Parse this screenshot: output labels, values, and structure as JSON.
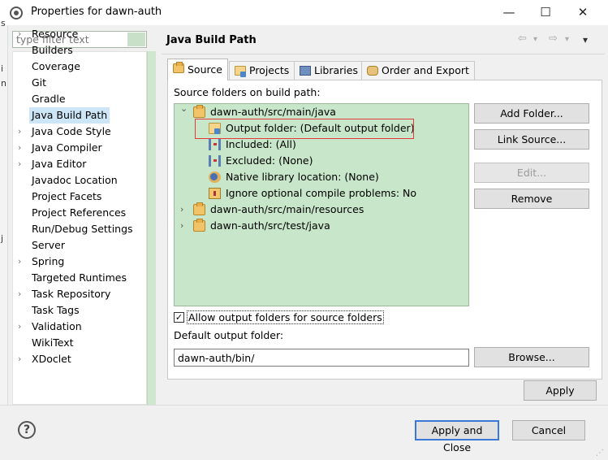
{
  "window": {
    "title": "Properties for dawn-auth",
    "minimize_glyph": "—",
    "maximize_glyph": "☐",
    "close_glyph": "✕"
  },
  "left_strip_chars": [
    "s",
    "i",
    "n",
    "j"
  ],
  "filter": {
    "placeholder": "type filter text"
  },
  "nav": [
    {
      "label": "Resource",
      "expandable": true
    },
    {
      "label": "Builders",
      "expandable": false
    },
    {
      "label": "Coverage",
      "expandable": false
    },
    {
      "label": "Git",
      "expandable": false
    },
    {
      "label": "Gradle",
      "expandable": false
    },
    {
      "label": "Java Build Path",
      "expandable": false,
      "selected": true
    },
    {
      "label": "Java Code Style",
      "expandable": true
    },
    {
      "label": "Java Compiler",
      "expandable": true
    },
    {
      "label": "Java Editor",
      "expandable": true
    },
    {
      "label": "Javadoc Location",
      "expandable": false
    },
    {
      "label": "Project Facets",
      "expandable": false
    },
    {
      "label": "Project References",
      "expandable": false
    },
    {
      "label": "Run/Debug Settings",
      "expandable": false
    },
    {
      "label": "Server",
      "expandable": false
    },
    {
      "label": "Spring",
      "expandable": true
    },
    {
      "label": "Targeted Runtimes",
      "expandable": false
    },
    {
      "label": "Task Repository",
      "expandable": true
    },
    {
      "label": "Task Tags",
      "expandable": false
    },
    {
      "label": "Validation",
      "expandable": true
    },
    {
      "label": "WikiText",
      "expandable": false
    },
    {
      "label": "XDoclet",
      "expandable": true
    }
  ],
  "page": {
    "title": "Java Build Path",
    "back_glyph": "⇦",
    "forward_glyph": "⇨",
    "menu_glyph": "▾"
  },
  "tabs": [
    {
      "label": "Source",
      "active": true
    },
    {
      "label": "Projects",
      "active": false
    },
    {
      "label": "Libraries",
      "active": false
    },
    {
      "label": "Order and Export",
      "active": false
    }
  ],
  "source": {
    "section_label": "Source folders on build path:",
    "tree": [
      {
        "label": "dawn-auth/src/main/java",
        "level": 0,
        "icon": "package-folder-icon",
        "chevron": "⌄"
      },
      {
        "label": "Output folder: (Default output folder)",
        "level": 1,
        "icon": "output-folder-icon",
        "highlighted": true
      },
      {
        "label": "Included: (All)",
        "level": 1,
        "icon": "inclusion-filter-icon"
      },
      {
        "label": "Excluded: (None)",
        "level": 1,
        "icon": "exclusion-filter-icon"
      },
      {
        "label": "Native library location: (None)",
        "level": 1,
        "icon": "native-library-icon"
      },
      {
        "label": "Ignore optional compile problems: No",
        "level": 1,
        "icon": "compile-problems-icon"
      },
      {
        "label": "dawn-auth/src/main/resources",
        "level": 0,
        "icon": "package-folder-icon",
        "chevron": "›"
      },
      {
        "label": "dawn-auth/src/test/java",
        "level": 0,
        "icon": "package-folder-icon",
        "chevron": "›"
      }
    ],
    "buttons": {
      "add_folder": "Add Folder...",
      "link_source": "Link Source...",
      "edit": "Edit...",
      "remove": "Remove",
      "browse": "Browse..."
    },
    "allow_output_label": "Allow output folders for source folders",
    "allow_output_checked": true,
    "check_glyph": "✓",
    "default_output_label": "Default output folder:",
    "default_output_value": "dawn-auth/bin/"
  },
  "footer": {
    "apply": "Apply",
    "apply_close": "Apply and Close",
    "cancel": "Cancel",
    "help_glyph": "?",
    "grip_glyph": "⋰"
  }
}
